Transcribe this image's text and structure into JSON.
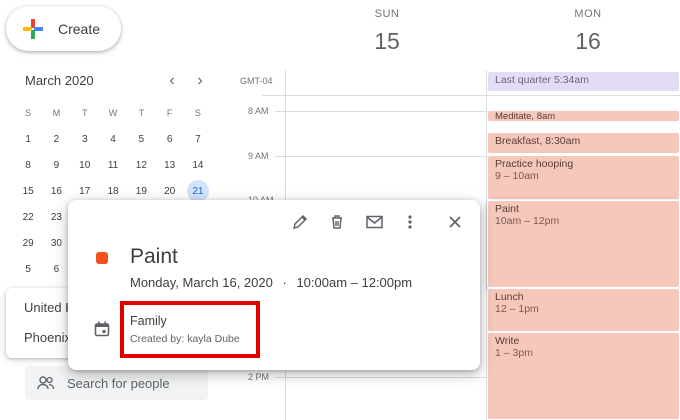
{
  "create_label": "Create",
  "mini_calendar": {
    "month_label": "March 2020",
    "weekdays": [
      "S",
      "M",
      "T",
      "W",
      "T",
      "F",
      "S"
    ],
    "weeks": [
      [
        "1",
        "2",
        "3",
        "4",
        "5",
        "6",
        "7"
      ],
      [
        "8",
        "9",
        "10",
        "11",
        "12",
        "13",
        "14"
      ],
      [
        "15",
        "16",
        "17",
        "18",
        "19",
        "20",
        "21"
      ],
      [
        "22",
        "23",
        "",
        "",
        "",
        "",
        ""
      ],
      [
        "29",
        "30",
        "",
        "",
        "",
        "",
        ""
      ],
      [
        "5",
        "6",
        "",
        "",
        "",
        "",
        ""
      ]
    ],
    "today": "21"
  },
  "timezone": "GMT-04",
  "hours": [
    "8 AM",
    "9 AM",
    "10 AM",
    "2 PM"
  ],
  "days": [
    {
      "name": "SUN",
      "date": "15"
    },
    {
      "name": "MON",
      "date": "16"
    }
  ],
  "events": [
    {
      "title": "Last quarter 5:34am",
      "time": ""
    },
    {
      "title": "Meditate, 8am",
      "time": ""
    },
    {
      "title": "Breakfast, 8:30am",
      "time": ""
    },
    {
      "title": "Practice hooping",
      "time": "9 – 10am"
    },
    {
      "title": "Paint",
      "time": "10am – 12pm"
    },
    {
      "title": "Lunch",
      "time": "12 – 1pm"
    },
    {
      "title": "Write",
      "time": "1 – 3pm"
    }
  ],
  "other_calendars": [
    "United K",
    "Phoenix"
  ],
  "search_people_placeholder": "Search for people",
  "popup": {
    "title": "Paint",
    "date": "Monday, March 16, 2020",
    "separator": "·",
    "time": "10:00am – 12:00pm",
    "calendar_name": "Family",
    "created_by": "Created by: kayla Dube",
    "event_color": "#f4511e"
  },
  "colors": {
    "event_bg": "#f6c7bb",
    "highlight_border": "#e00000",
    "today_bg": "#d2e3fc"
  }
}
